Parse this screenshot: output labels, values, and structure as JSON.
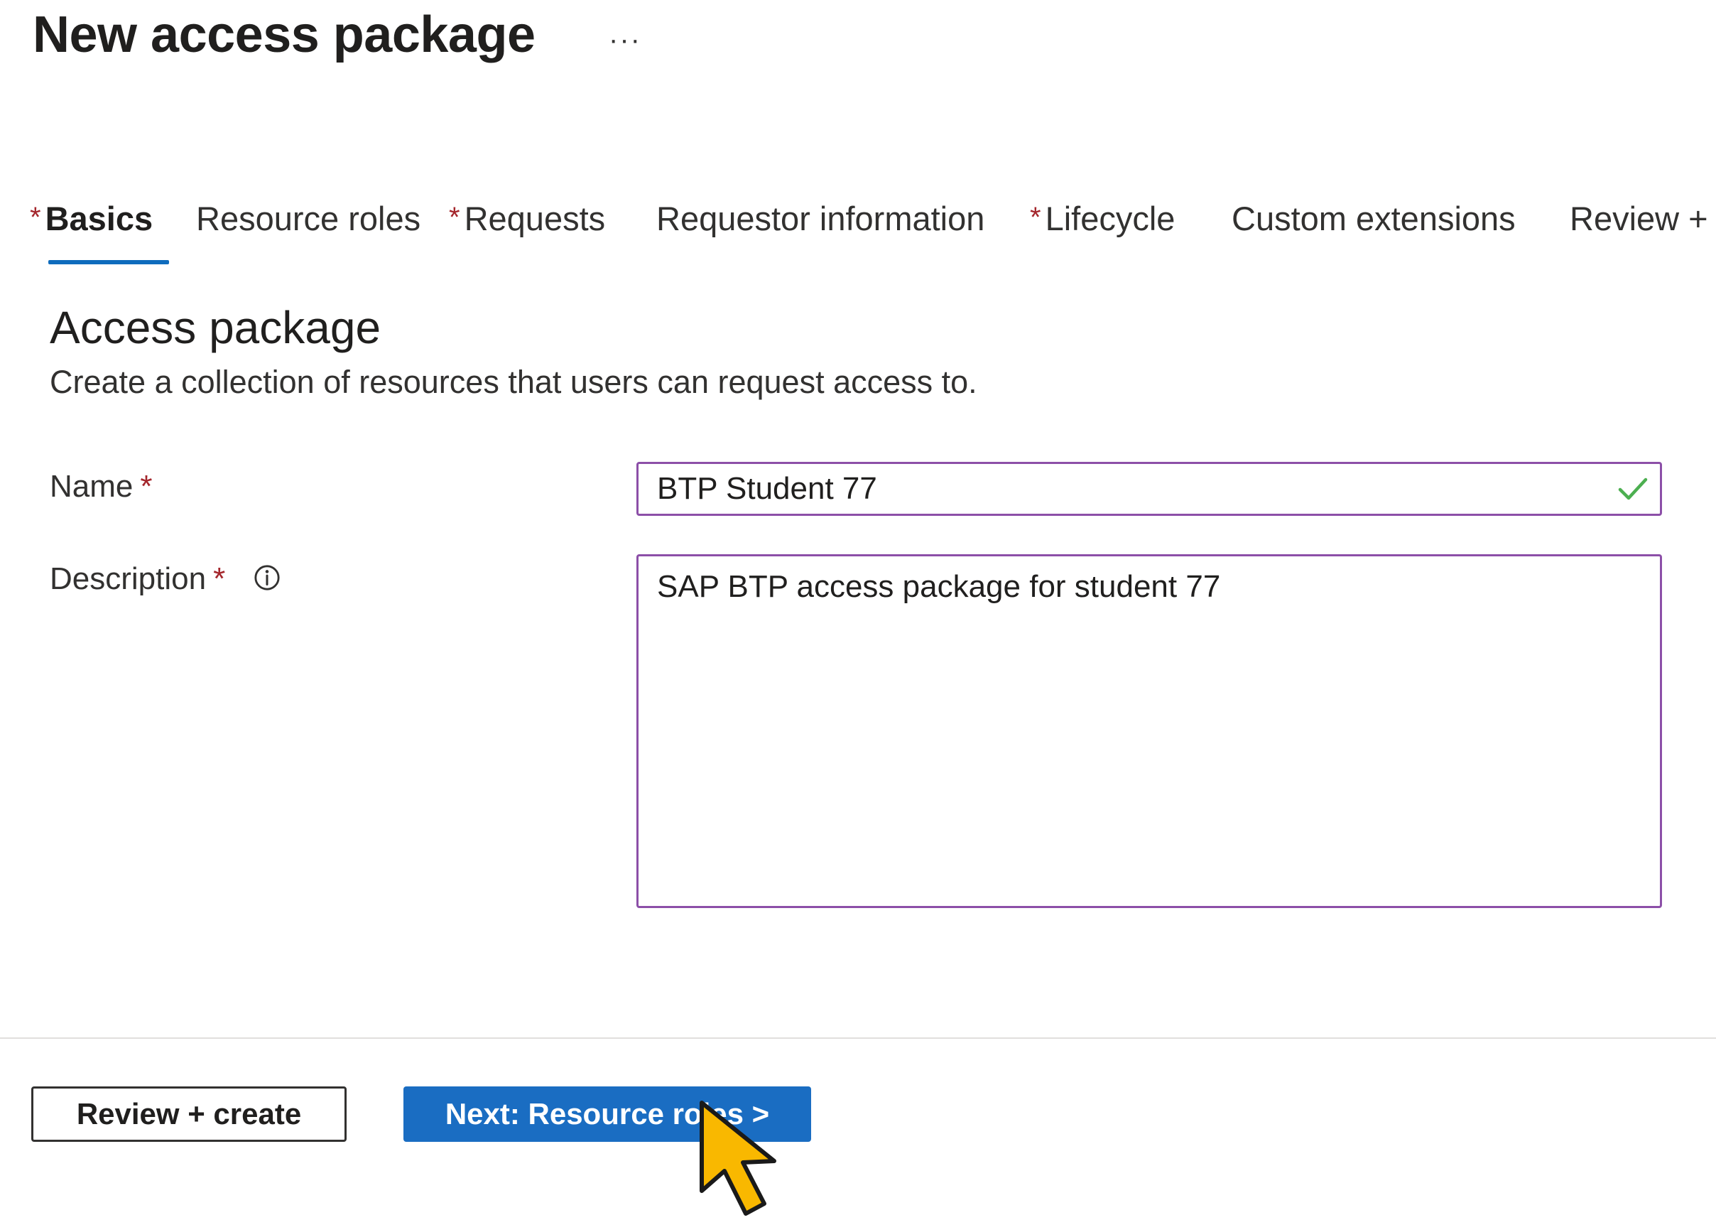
{
  "header": {
    "title": "New access package",
    "more_label": "···"
  },
  "tabs": [
    {
      "label": "Basics",
      "required": true,
      "active": true
    },
    {
      "label": "Resource roles",
      "required": false,
      "active": false
    },
    {
      "label": "Requests",
      "required": true,
      "active": false
    },
    {
      "label": "Requestor information",
      "required": false,
      "active": false
    },
    {
      "label": "Lifecycle",
      "required": true,
      "active": false
    },
    {
      "label": "Custom extensions",
      "required": false,
      "active": false
    },
    {
      "label": "Review + c",
      "required": false,
      "active": false
    }
  ],
  "required_marker": "*",
  "section": {
    "title": "Access package",
    "description": "Create a collection of resources that users can request access to."
  },
  "form": {
    "name_label": "Name",
    "name_value": "BTP Student 77",
    "name_valid": true,
    "description_label": "Description",
    "description_value": "SAP BTP access package for student 77"
  },
  "footer": {
    "review_create_label": "Review + create",
    "next_label": "Next: Resource roles >"
  },
  "colors": {
    "accent": "#0f6cbd",
    "primary_button": "#1a6dc2",
    "required": "#a4262c",
    "input_border": "#8c4fa8",
    "valid_check": "#4caf50",
    "cursor_fill": "#f9b800"
  },
  "icons": {
    "more": "more-icon",
    "info": "info-icon",
    "check": "checkmark-icon",
    "cursor": "mouse-pointer-icon"
  }
}
